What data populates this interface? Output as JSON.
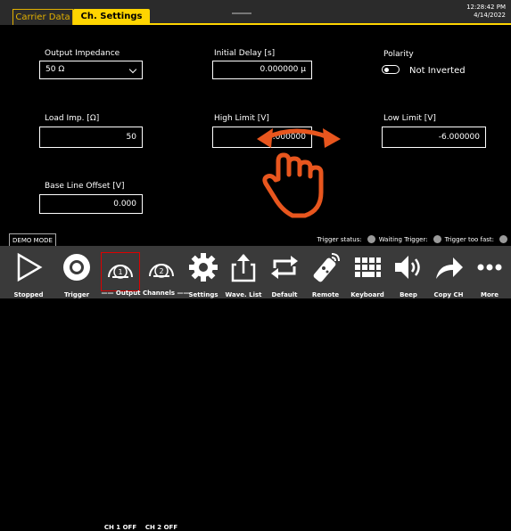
{
  "tabs": [
    {
      "label": "Carrier Data",
      "active": false
    },
    {
      "label": "Ch. Settings",
      "active": true
    }
  ],
  "clock": {
    "time": "12:28:42 PM",
    "date": "4/14/2022"
  },
  "settings": {
    "output_impedance": {
      "label": "Output Impedance",
      "value": "50 Ω"
    },
    "initial_delay": {
      "label": "Initial Delay [s]",
      "value": "0.000000 μ"
    },
    "polarity": {
      "label": "Polarity",
      "value": "Not Inverted"
    },
    "load_imp": {
      "label": "Load Imp. [Ω]",
      "value": "50"
    },
    "high_limit": {
      "label": "High Limit [V]",
      "value": "6.000000"
    },
    "low_limit": {
      "label": "Low Limit [V]",
      "value": "-6.000000"
    },
    "base_line_offset": {
      "label": "Base Line Offset [V]",
      "value": "0.000"
    }
  },
  "demo_mode": "DEMO MODE",
  "trigger_status": {
    "status_label": "Trigger status:",
    "waiting_label": "Waiting Trigger:",
    "too_fast_label": "Trigger too fast:"
  },
  "toolbar": {
    "group_label": "Output Channels",
    "items": [
      {
        "label": "Stopped",
        "icon": "play-icon"
      },
      {
        "label": "Trigger",
        "icon": "trigger-icon"
      },
      {
        "label": "CH 1 OFF",
        "icon": "channel-1-icon",
        "number": "1"
      },
      {
        "label": "CH 2 OFF",
        "icon": "channel-2-icon",
        "number": "2"
      },
      {
        "label": "Settings",
        "icon": "gear-icon"
      },
      {
        "label": "Wave. List",
        "icon": "upload-icon"
      },
      {
        "label": "Default",
        "icon": "loop-icon"
      },
      {
        "label": "Remote",
        "icon": "remote-icon"
      },
      {
        "label": "Keyboard",
        "icon": "keyboard-icon"
      },
      {
        "label": "Beep",
        "icon": "speaker-icon"
      },
      {
        "label": "Copy CH",
        "icon": "share-arrow-icon"
      },
      {
        "label": "More",
        "icon": "more-icon"
      }
    ]
  },
  "colors": {
    "accent": "#ffd500",
    "overlay": "#e8561e",
    "selected_border": "#dd0000"
  }
}
